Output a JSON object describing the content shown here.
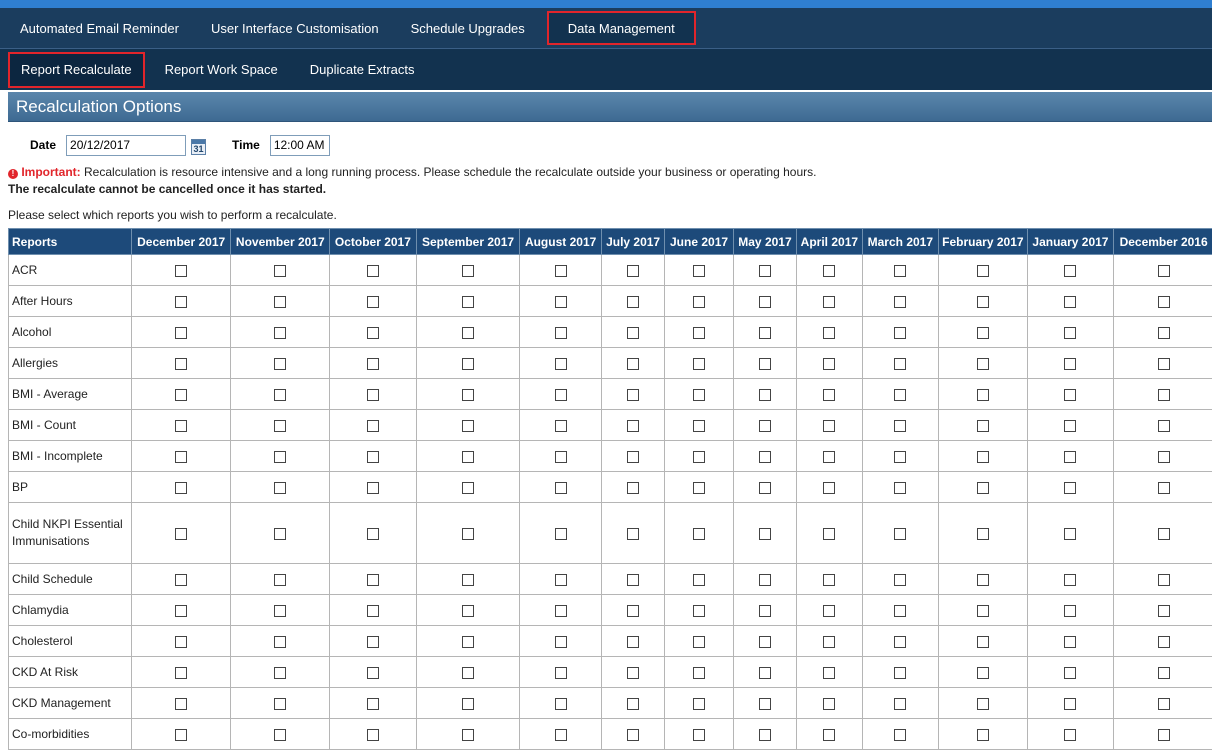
{
  "nav_primary": {
    "tabs": [
      {
        "label": "Automated Email Reminder",
        "active": false
      },
      {
        "label": "User Interface Customisation",
        "active": false
      },
      {
        "label": "Schedule Upgrades",
        "active": false
      },
      {
        "label": "Data Management",
        "active": true
      }
    ]
  },
  "nav_secondary": {
    "tabs": [
      {
        "label": "Report Recalculate",
        "active": true
      },
      {
        "label": "Report Work Space",
        "active": false
      },
      {
        "label": "Duplicate Extracts",
        "active": false
      }
    ]
  },
  "section": {
    "title": "Recalculation Options"
  },
  "schedule": {
    "date_label": "Date",
    "date_value": "20/12/2017",
    "calendar_icon_text": "31",
    "time_label": "Time",
    "time_value": "12:00 AM"
  },
  "notice": {
    "important_label": "Important:",
    "important_text": "Recalculation is resource intensive and a long running process. Please schedule the recalculate outside your business or operating hours.",
    "warning": "The recalculate cannot be cancelled once it has started.",
    "instruction": "Please select which reports you wish to perform a recalculate."
  },
  "table": {
    "columns": [
      "Reports",
      "December 2017",
      "November 2017",
      "October 2017",
      "September 2017",
      "August 2017",
      "July 2017",
      "June 2017",
      "May 2017",
      "April 2017",
      "March 2017",
      "February 2017",
      "January 2017",
      "December 2016"
    ],
    "rows": [
      {
        "name": "ACR",
        "tall": false
      },
      {
        "name": "After Hours",
        "tall": false
      },
      {
        "name": "Alcohol",
        "tall": false
      },
      {
        "name": "Allergies",
        "tall": false
      },
      {
        "name": "BMI - Average",
        "tall": false
      },
      {
        "name": "BMI - Count",
        "tall": false
      },
      {
        "name": "BMI - Incomplete",
        "tall": false
      },
      {
        "name": "BP",
        "tall": false
      },
      {
        "name": "Child NKPI Essential Immunisations",
        "tall": true
      },
      {
        "name": "Child Schedule",
        "tall": false
      },
      {
        "name": "Chlamydia",
        "tall": false
      },
      {
        "name": "Cholesterol",
        "tall": false
      },
      {
        "name": "CKD At Risk",
        "tall": false
      },
      {
        "name": "CKD Management",
        "tall": false
      },
      {
        "name": "Co-morbidities",
        "tall": false
      }
    ]
  },
  "colors": {
    "nav_bg": "#1b3d5e",
    "highlight_border": "#e1252b",
    "header_bg": "#1d4a7a",
    "important": "#e1252b"
  }
}
